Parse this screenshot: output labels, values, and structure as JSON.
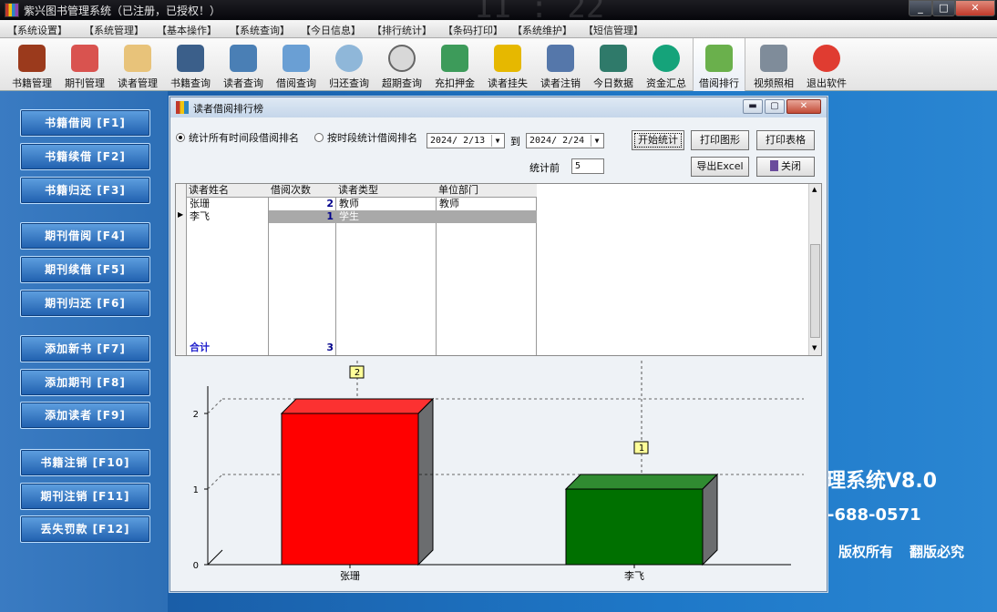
{
  "window": {
    "title": "紫兴图书管理系统（已注册，已授权！）",
    "min_glyph": "_",
    "max_glyph": "□",
    "close_glyph": "✕",
    "ghost_clock": "11 : 22"
  },
  "menu": [
    "【系统设置】",
    "【系统管理】",
    "【基本操作】",
    "【系统查询】",
    "【今日信息】",
    "【排行统计】",
    "【条码打印】",
    "【系统维护】",
    "【短信管理】"
  ],
  "toolbar": [
    {
      "label": "书籍管理",
      "icon": "books-icon",
      "color": "#9b3a1c"
    },
    {
      "label": "期刊管理",
      "icon": "magazine-icon",
      "color": "#d9534f"
    },
    {
      "label": "读者管理",
      "icon": "reader-card-icon",
      "color": "#e8c37a"
    },
    {
      "label": "书籍查询",
      "icon": "book-search-icon",
      "color": "#3b5f8a"
    },
    {
      "label": "读者查询",
      "icon": "user-search-icon",
      "color": "#4a7fb5"
    },
    {
      "label": "借阅查询",
      "icon": "window-search-icon",
      "color": "#6a9fd4"
    },
    {
      "label": "归还查询",
      "icon": "magnifier-icon",
      "color": "#8fb7d9"
    },
    {
      "label": "超期查询",
      "icon": "clock-icon",
      "color": "#b0b0b0"
    },
    {
      "label": "充扣押金",
      "icon": "deposit-icon",
      "color": "#3d9b5a"
    },
    {
      "label": "读者挂失",
      "icon": "user-lock-icon",
      "color": "#e6b800"
    },
    {
      "label": "读者注销",
      "icon": "user-cancel-icon",
      "color": "#5577aa"
    },
    {
      "label": "今日数据",
      "icon": "document-icon",
      "color": "#2f7a6a"
    },
    {
      "label": "资金汇总",
      "icon": "yen-icon",
      "color": "#15a37a"
    },
    {
      "label": "借阅排行",
      "icon": "ranking-icon",
      "color": "#6ab04c"
    },
    {
      "label": "视频照相",
      "icon": "camera-icon",
      "color": "#7f8c9a"
    },
    {
      "label": "退出软件",
      "icon": "exit-icon",
      "color": "#e03c31"
    }
  ],
  "sidebar": [
    {
      "label": "书籍借阅 [F1]"
    },
    {
      "label": "书籍续借 [F2]"
    },
    {
      "label": "书籍归还 [F3]"
    },
    {
      "label": "期刊借阅 [F4]"
    },
    {
      "label": "期刊续借 [F5]"
    },
    {
      "label": "期刊归还 [F6]"
    },
    {
      "label": "添加新书 [F7]"
    },
    {
      "label": "添加期刊 [F8]"
    },
    {
      "label": "添加读者 [F9]"
    },
    {
      "label": "书籍注销 [F10]"
    },
    {
      "label": "期刊注销 [F11]"
    },
    {
      "label": "丢失罚款 [F12]"
    }
  ],
  "background": {
    "version": "理系统V8.0",
    "phone": "-688-0571",
    "copyright1": "版权所有",
    "copyright2": "翻版必究"
  },
  "ranking_window": {
    "title": "读者借阅排行榜",
    "min_glyph": "▬",
    "max_glyph": "▢",
    "close_glyph": "✕",
    "option_all": "统计所有时间段借阅排名",
    "option_range": "按时段统计借阅排名",
    "date_from": "2024/ 2/13",
    "to_label": "到",
    "date_to": "2024/ 2/24",
    "top_label": "统计前",
    "top_value": "5",
    "btn_start": "开始统计",
    "btn_print_chart": "打印图形",
    "btn_print_table": "打印表格",
    "btn_export": "导出Excel",
    "btn_close": "关闭",
    "columns": [
      "读者姓名",
      "借阅次数",
      "读者类型",
      "单位部门"
    ],
    "rows": [
      {
        "name": "张珊",
        "count": "2",
        "type": "教师",
        "dept": "教师"
      },
      {
        "name": "李飞",
        "count": "1",
        "type": "学生",
        "dept": ""
      }
    ],
    "total_label": "合计",
    "total_value": "3"
  },
  "chart_data": {
    "type": "bar",
    "categories": [
      "张珊",
      "李飞"
    ],
    "values": [
      2,
      1
    ],
    "data_labels": [
      "2",
      "1"
    ],
    "bar_colors": [
      "#ff0000",
      "#007000"
    ],
    "yticks": [
      "0",
      "1",
      "2"
    ],
    "ylim": [
      0,
      2.0
    ],
    "grid": true,
    "style": "3d"
  }
}
